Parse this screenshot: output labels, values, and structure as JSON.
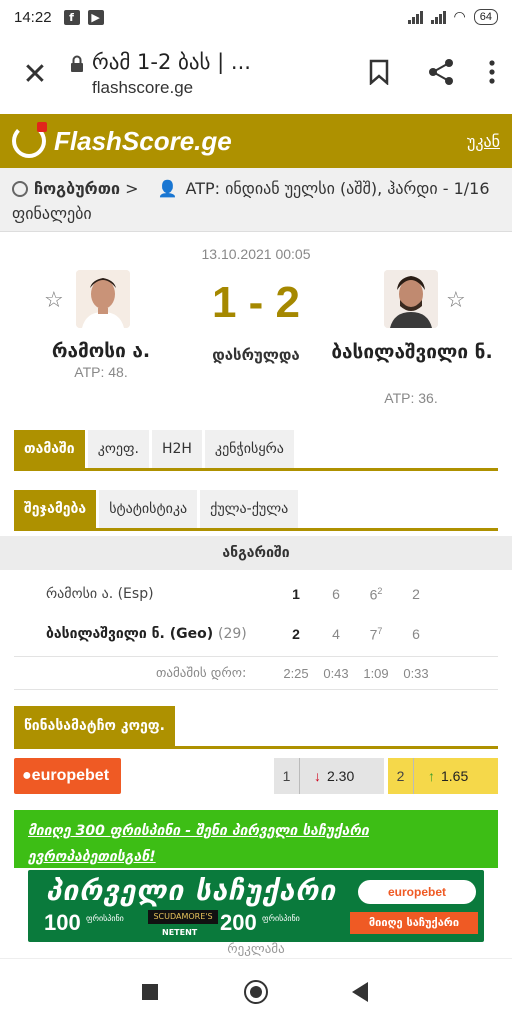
{
  "status_bar": {
    "time": "14:22",
    "battery": "64"
  },
  "browser": {
    "page_title": "რამ 1-2 ბას | ...",
    "url": "flashscore.ge"
  },
  "site": {
    "logo": "FlashScore.ge",
    "back_link": "უკან"
  },
  "breadcrumb": {
    "sport": "ჩოგბურთი",
    "separator": ">",
    "tournament": "ATP: ინდიან უელსი (აშშ), ჰარდი - 1/16 ფინალები"
  },
  "match": {
    "datetime": "13.10.2021 00:05",
    "score": "1 - 2",
    "status": "დასრულდა",
    "home": {
      "name": "რამოსი ა.",
      "rank": "ATP: 48."
    },
    "away": {
      "name": "ბასილაშვილი ნ.",
      "rank": "ATP: 36."
    }
  },
  "main_tabs": [
    "თამაში",
    "კოეფ.",
    "H2H",
    "კენჭისყრა"
  ],
  "sub_tabs": [
    "შეჯამება",
    "სტატისტიკა",
    "ქულა-ქულა"
  ],
  "scoreboard": {
    "header": "ანგარიში",
    "rows": [
      {
        "name": "რამოსი ა. (Esp)",
        "rank": "",
        "total": "1",
        "sets": [
          "6",
          "6",
          "2"
        ],
        "tiebreak": "2"
      },
      {
        "name": "ბასილაშვილი ნ. (Geo)",
        "rank": "(29)",
        "total": "2",
        "sets": [
          "4",
          "7",
          "6"
        ],
        "tiebreak": "7"
      }
    ],
    "duration_label": "თამაშის დრო:",
    "durations": [
      "2:25",
      "0:43",
      "1:09",
      "0:33"
    ]
  },
  "odds": {
    "header": "წინასამატჩო კოეფ.",
    "bookmaker": "europebet",
    "home": {
      "label": "1",
      "value": "2.30",
      "trend": "down"
    },
    "away": {
      "label": "2",
      "value": "1.65",
      "trend": "up"
    },
    "colors": {
      "down": "#d0021b",
      "up": "#3d9e2a",
      "away_bg": "#f5d84a",
      "home_bg": "#e4e4e4"
    }
  },
  "promo": {
    "text": "მიიღე 300 ფრისპინი - შენი პირველი საჩუქარი ევროპაბეთისგან!"
  },
  "banner": {
    "title": "პირველი საჩუქარი",
    "num1": "100",
    "num1_label": "ფრისპინი",
    "num2": "200",
    "num2_label": "ფრისპინი",
    "mid": "SCUDAMORE'S",
    "netent": "NETENT",
    "logo": "europebet",
    "button": "მიიღე საჩუქარი"
  },
  "ad_label": "რეკლამა",
  "brand_colors": {
    "gold": "#ae9100",
    "orange": "#ef5a24",
    "green": "#3dbe15"
  }
}
